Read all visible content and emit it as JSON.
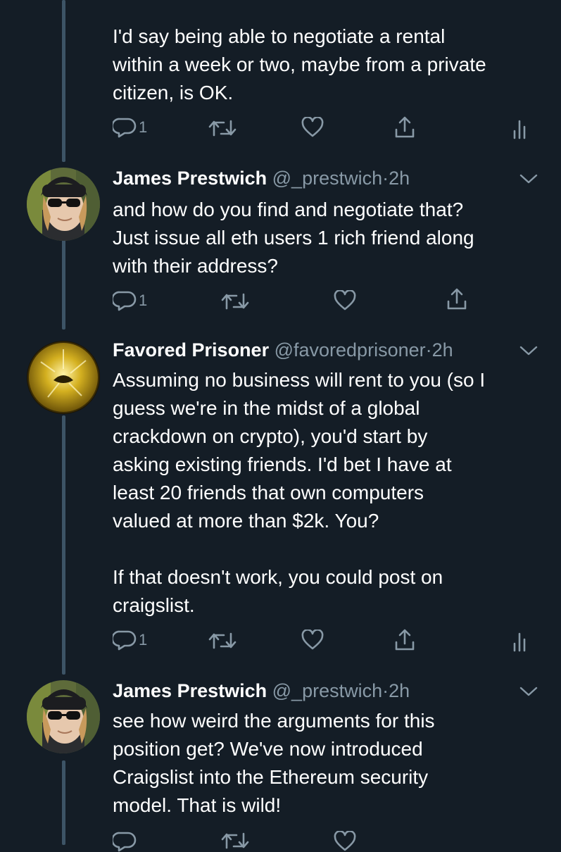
{
  "colors": {
    "background": "#141d26",
    "text": "#ffffff",
    "secondary": "#8899a6",
    "thread_line": "#3d5466"
  },
  "tweets": [
    {
      "text": "I'd say being able to negotiate a rental\nwithin a week or two, maybe from a private\ncitizen, is OK.",
      "replies": "1"
    },
    {
      "name": "James Prestwich",
      "handle": "@_prestwich",
      "separator": "·",
      "time": "2h",
      "text": "and how do you find and negotiate that?\nJust issue all eth users 1 rich friend along\nwith their address?",
      "replies": "1"
    },
    {
      "name": "Favored Prisoner",
      "handle": "@favoredprisoner",
      "separator": "·",
      "time": "2h",
      "text": "Assuming no business will rent to you (so I\nguess we're in the midst of a global\ncrackdown on crypto), you'd start by\nasking existing friends. I'd bet I have at\nleast 20 friends that own computers\nvalued at more than $2k. You?\n\nIf that doesn't work, you could post on\ncraigslist.",
      "replies": "1"
    },
    {
      "name": "James Prestwich",
      "handle": "@_prestwich",
      "separator": "·",
      "time": "2h",
      "text": "see how weird the arguments for this\nposition get? We've now introduced\nCraigslist into the Ethereum security\nmodel. That is wild!"
    }
  ]
}
